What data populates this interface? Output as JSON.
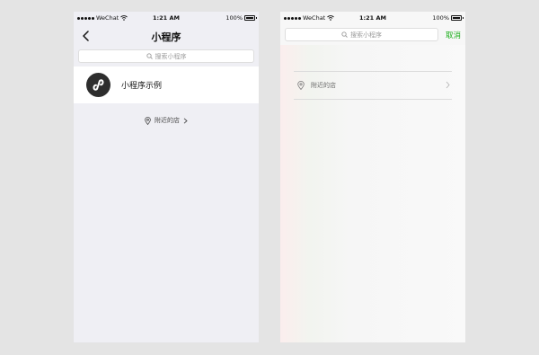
{
  "status": {
    "carrier": "WeChat",
    "time": "1:21 AM",
    "battery": "100%"
  },
  "left": {
    "title": "小程序",
    "search_placeholder": "搜索小程序",
    "app_name": "小程序示例",
    "nearby_label": "附近的店"
  },
  "right": {
    "search_placeholder": "搜索小程序",
    "cancel_label": "取消",
    "nearby_label": "附近的店"
  },
  "colors": {
    "accent": "#1aad19",
    "page_bg": "#e4e4e4",
    "list_bg": "#efeff4"
  }
}
